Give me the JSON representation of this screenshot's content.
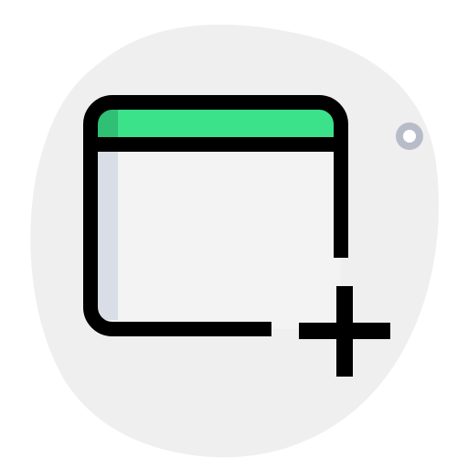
{
  "icon": {
    "name": "add-new-window-icon",
    "colors": {
      "blob": "#efefef",
      "titlebar": "#3ce28a",
      "titlebar_shade": "#2fbf75",
      "window_body": "#f3f3f3",
      "window_shade": "#d8dde6",
      "stroke": "#000000",
      "dot_ring": "#b7bcc8"
    }
  }
}
